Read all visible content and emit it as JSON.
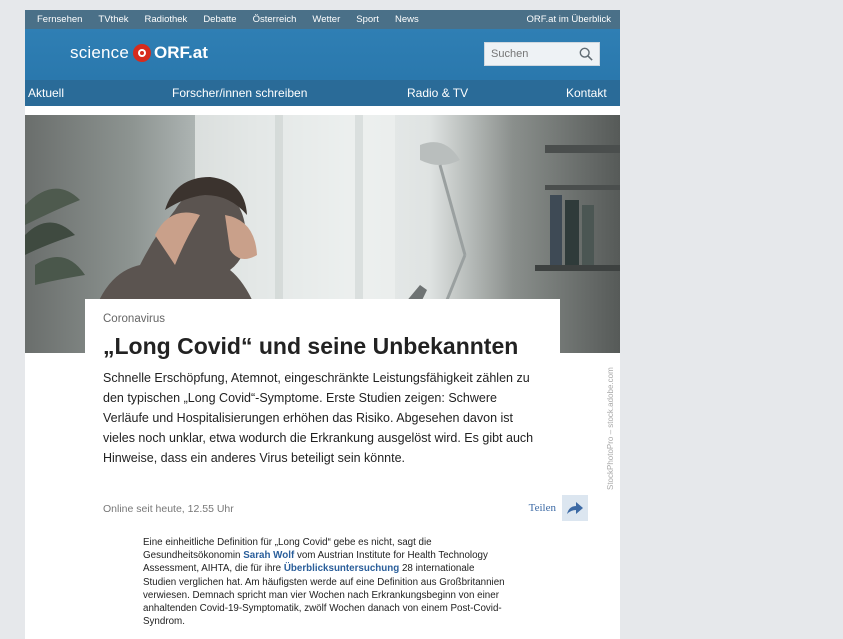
{
  "topnav": {
    "items": [
      "Fernsehen",
      "TVthek",
      "Radiothek",
      "Debatte",
      "Österreich",
      "Wetter",
      "Sport",
      "News",
      "ORF.at im Überblick"
    ]
  },
  "header": {
    "logo_science": "science",
    "logo_orf": "ORF.at",
    "search_placeholder": "Suchen"
  },
  "mainnav": {
    "items": [
      "Aktuell",
      "Forscher/innen schreiben",
      "Radio & TV",
      "Kontakt"
    ]
  },
  "hero": {
    "credit": "StockPhotoPro – stock.adobe.com"
  },
  "article": {
    "kicker": "Coronavirus",
    "title": "„Long Covid“ und seine Unbekannten",
    "lead": "Schnelle Erschöpfung, Atemnot, eingeschränkte Leistungsfähigkeit zählen zu den typischen „Long Covid“-Symptome. Erste Studien zeigen: Schwere Verläufe und Hospitalisierungen erhöhen das Risiko. Abgesehen davon ist vieles noch unklar, etwa wodurch die Erkrankung ausgelöst wird. Es gibt auch Hinweise, dass ein anderes Virus beteiligt sein könnte.",
    "date": "Online seit heute, 12.55 Uhr",
    "share_label": "Teilen",
    "body_part1": "Eine einheitliche Definition für „Long Covid“ gebe es nicht, sagt die Gesundheitsökonomin ",
    "body_link1": "Sarah Wolf",
    "body_part2": " vom Austrian Institute for Health Technology Assessment, AIHTA, die für ihre ",
    "body_link2": "Überblicksuntersuchung",
    "body_part3": " 28 internationale Studien verglichen hat. Am häufigsten werde auf eine Definition aus Großbritannien verwiesen. Demnach spricht man vier Wochen nach Erkrankungsbeginn von einer anhaltenden Covid-19-Symptomatik, zwölf Wochen danach von einem Post-Covid-Syndrom."
  },
  "colors": {
    "topbar": "#4a7088",
    "header": "#2f7fb4",
    "mainnav": "#2a6b98",
    "orf_red": "#d62b1e",
    "link": "#2a5e9a"
  }
}
